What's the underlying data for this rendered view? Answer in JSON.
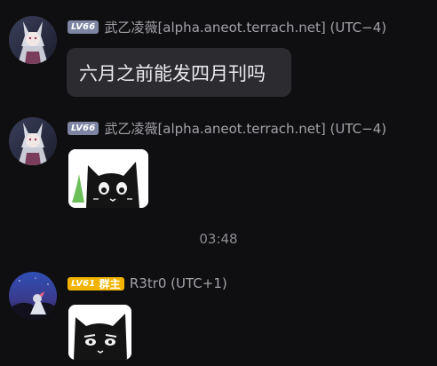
{
  "messages": [
    {
      "sender": {
        "level": "LV66",
        "name": "武乙凌薇[alpha.aneot.terrach.net] (UTC−4)"
      },
      "text": "六月之前能发四月刊吗"
    },
    {
      "sender": {
        "level": "LV66",
        "name": "武乙凌薇[alpha.aneot.terrach.net] (UTC−4)"
      },
      "sticker": "black-cat-sticker"
    },
    {
      "sender": {
        "level": "LV61",
        "role": "群主",
        "name": "R3tr0 (UTC+1)"
      },
      "sticker": "black-cat-glaring-sticker"
    }
  ],
  "timestamp": "03:48",
  "colors": {
    "background": "#0f0f11",
    "bubble": "#2b2b30",
    "level_badge": "#7d85a3",
    "owner_badge": "#f2b400"
  }
}
